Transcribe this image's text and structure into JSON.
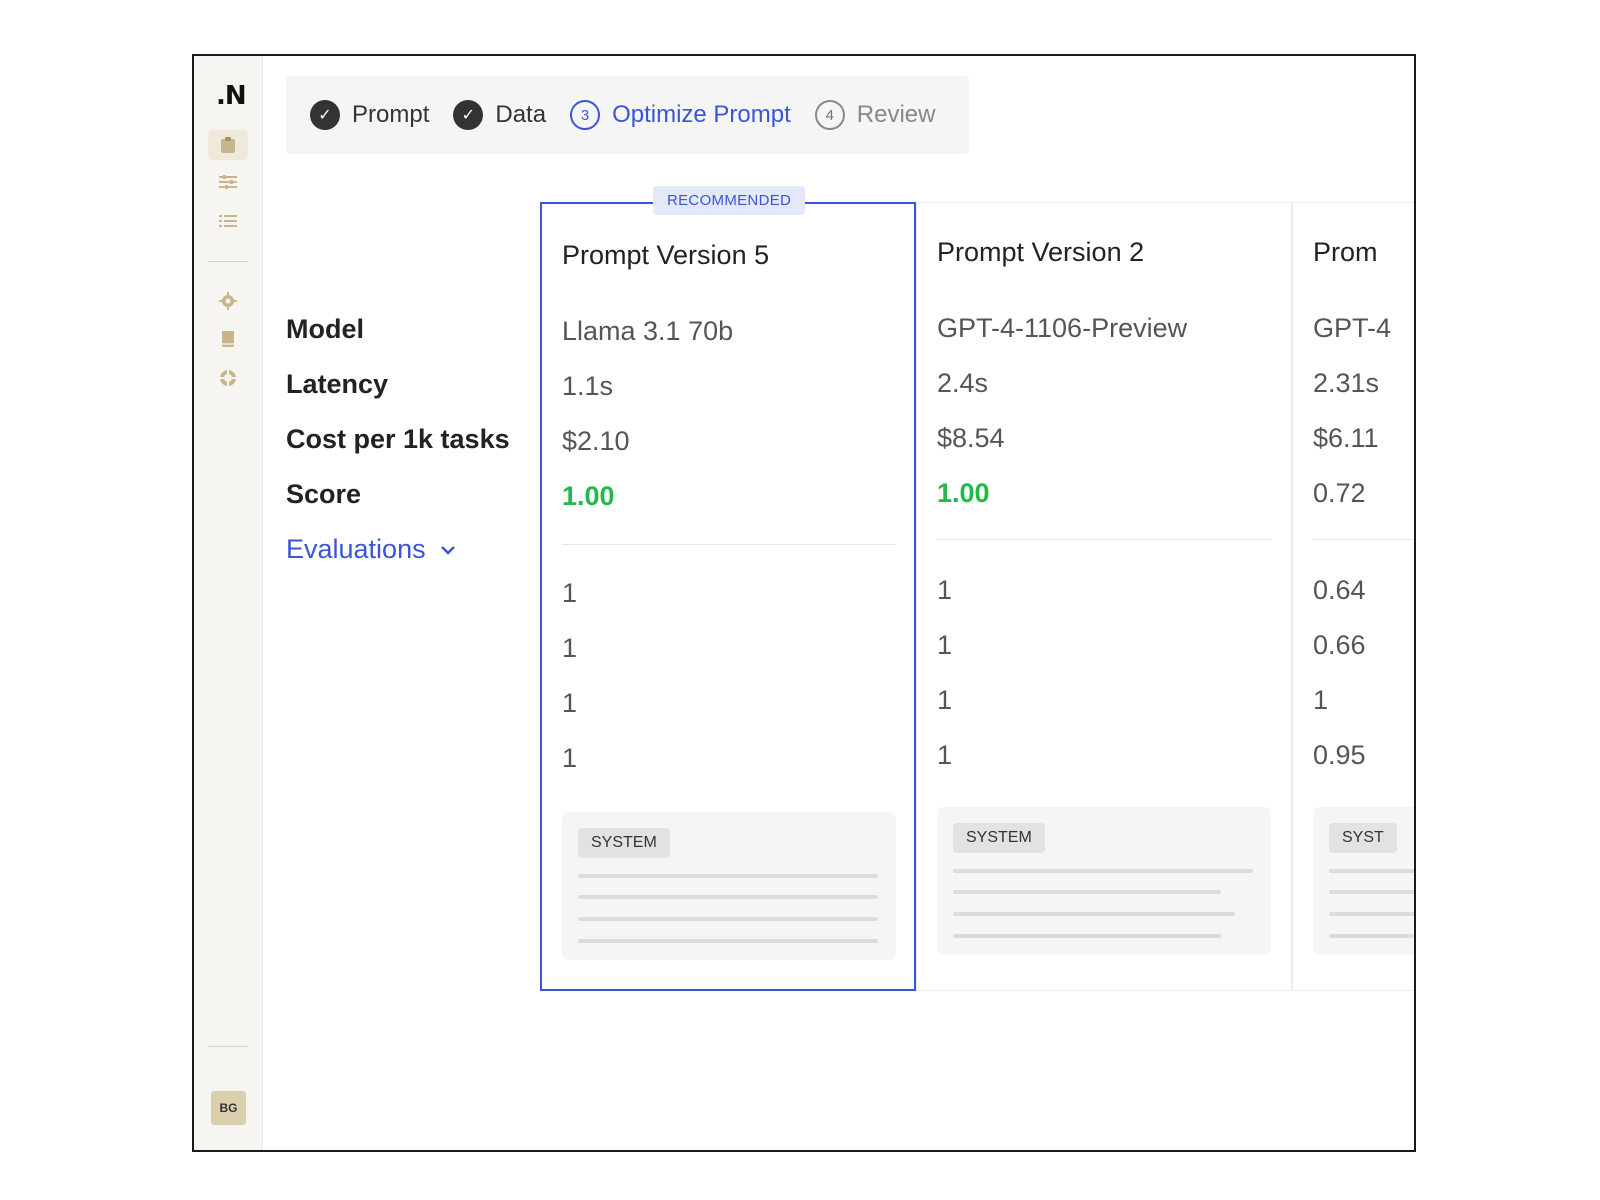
{
  "brand": {
    "logo": ".N"
  },
  "sidebar": {
    "icons": [
      "clipboard-icon",
      "sliders-icon",
      "list-icon",
      "gear-icon",
      "book-icon",
      "lifebuoy-icon"
    ],
    "avatar_initials": "BG"
  },
  "stepper": {
    "steps": [
      {
        "label": "Prompt",
        "state": "done"
      },
      {
        "label": "Data",
        "state": "done"
      },
      {
        "label": "Optimize Prompt",
        "number": "3",
        "state": "current"
      },
      {
        "label": "Review",
        "number": "4",
        "state": "pending"
      }
    ]
  },
  "rows": {
    "model": "Model",
    "latency": "Latency",
    "cost": "Cost per 1k tasks",
    "score": "Score",
    "evaluations": "Evaluations"
  },
  "columns": [
    {
      "badge": "RECOMMENDED",
      "title": "Prompt Version 5",
      "model": "Llama 3.1 70b",
      "latency": "1.1s",
      "cost": "$2.10",
      "score": "1.00",
      "evals": [
        "1",
        "1",
        "1",
        "1"
      ],
      "system_tag": "SYSTEM"
    },
    {
      "title": "Prompt Version 2",
      "model": "GPT-4-1106-Preview",
      "latency": "2.4s",
      "cost": "$8.54",
      "score": "1.00",
      "evals": [
        "1",
        "1",
        "1",
        "1"
      ],
      "system_tag": "SYSTEM"
    },
    {
      "title": "Prom",
      "model": "GPT-4",
      "latency": "2.31s",
      "cost": "$6.11",
      "score": "0.72",
      "evals": [
        "0.64",
        "0.66",
        "1",
        "0.95"
      ],
      "system_tag": "SYST"
    }
  ],
  "colors": {
    "accent": "#3b55d6",
    "good_score": "#22b84a"
  }
}
